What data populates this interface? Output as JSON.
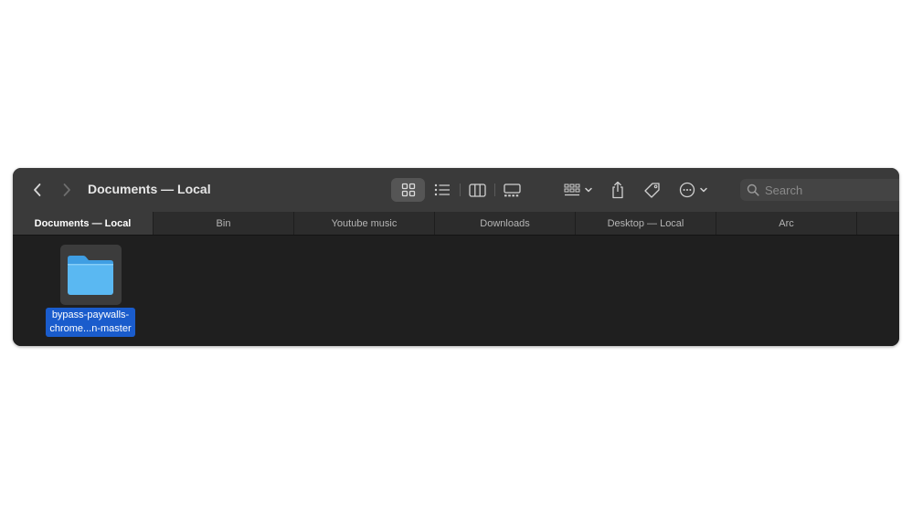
{
  "window": {
    "title": "Documents — Local"
  },
  "toolbar": {
    "back_icon": "chevron-left-icon",
    "forward_icon": "chevron-right-icon",
    "view_icons": "icon-view-icon",
    "view_list": "list-view-icon",
    "view_columns": "column-view-icon",
    "view_gallery": "gallery-view-icon",
    "group_icon": "group-by-icon",
    "share_icon": "share-icon",
    "tag_icon": "tag-icon",
    "more_icon": "ellipsis-circle-icon"
  },
  "search": {
    "placeholder": "Search"
  },
  "tabs": [
    {
      "label": "Documents — Local",
      "active": true
    },
    {
      "label": "Bin"
    },
    {
      "label": "Youtube music"
    },
    {
      "label": "Downloads"
    },
    {
      "label": "Desktop — Local"
    },
    {
      "label": "Arc"
    }
  ],
  "items": [
    {
      "name_line1": "bypass-paywalls-",
      "name_line2": "chrome...n-master",
      "icon": "folder-icon",
      "selected": true
    }
  ],
  "colors": {
    "accent": "#1a5ccc",
    "folder": "#5ab8f2"
  }
}
